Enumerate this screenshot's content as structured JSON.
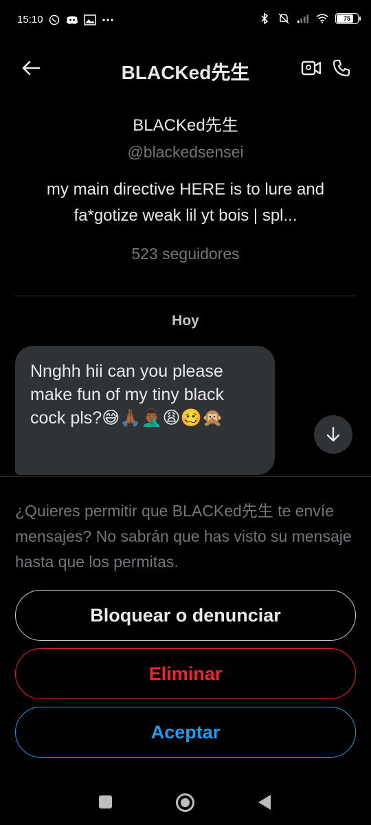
{
  "status_bar": {
    "time": "15:10",
    "battery_level": "75",
    "battery_fraction": 0.75,
    "icons_left": [
      "whatsapp-icon",
      "discord-icon",
      "image-icon",
      "more-dots-icon"
    ],
    "icons_right": [
      "bluetooth-icon",
      "mute-icon",
      "signal-icon",
      "wifi-icon",
      "battery-icon"
    ]
  },
  "header": {
    "title": "BLACKed先生",
    "back_icon": "arrow-left-icon",
    "video_icon": "video-call-icon",
    "call_icon": "phone-icon"
  },
  "profile": {
    "name": "BLACKed先生",
    "handle": "@blackedsensei",
    "bio": "my main directive HERE is to lure and fa*gotize weak lil yt bois | spl...",
    "followers": "523 seguidores"
  },
  "conversation": {
    "day_label": "Hoy",
    "messages": [
      {
        "text": "Nnghh hii can you please make fun of my tiny black cock pls?😅🙏🏾🤦🏾‍♂️😩🥴🙊"
      }
    ],
    "scroll_icon": "arrow-down-icon"
  },
  "request": {
    "text": "¿Quieres permitir que BLACKed先生 te envíe mensajes? No sabrán que has visto su mensaje hasta que los permitas.",
    "block_label": "Bloquear o denunciar",
    "delete_label": "Eliminar",
    "accept_label": "Aceptar"
  },
  "colors": {
    "background": "#000000",
    "text": "#e7e9ea",
    "muted": "#71767b",
    "bubble": "#2f3336",
    "danger": "#f4212e",
    "accent": "#1d9bf0"
  },
  "navbar": {
    "icons": [
      "recents-square-icon",
      "home-circle-icon",
      "back-triangle-icon"
    ]
  }
}
